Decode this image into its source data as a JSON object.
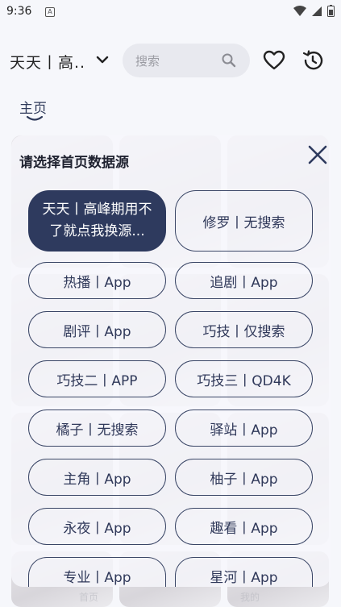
{
  "status_bar": {
    "time": "9:36",
    "notif_icon": "a-icon"
  },
  "header": {
    "source_label": "天天丨高..",
    "search_placeholder": "搜索"
  },
  "tabs": [
    {
      "label": "主页"
    }
  ],
  "background_nav": {
    "left_label": "首页",
    "right_label": "我的"
  },
  "dialog": {
    "title": "请选择首页数据源",
    "options": [
      {
        "label": "天天丨高峰期用不了就点我换源...",
        "selected": true
      },
      {
        "label": "修罗丨无搜索",
        "selected": false
      },
      {
        "label": "热播丨App",
        "selected": false
      },
      {
        "label": "追剧丨App",
        "selected": false
      },
      {
        "label": "剧评丨App",
        "selected": false
      },
      {
        "label": "巧技丨仅搜索",
        "selected": false
      },
      {
        "label": "巧技二丨APP",
        "selected": false
      },
      {
        "label": "巧技三丨QD4K",
        "selected": false
      },
      {
        "label": "橘子丨无搜索",
        "selected": false
      },
      {
        "label": "驿站丨App",
        "selected": false
      },
      {
        "label": "主角丨App",
        "selected": false
      },
      {
        "label": "柚子丨App",
        "selected": false
      },
      {
        "label": "永夜丨App",
        "selected": false
      },
      {
        "label": "趣看丨App",
        "selected": false
      },
      {
        "label": "专业丨App",
        "selected": false
      },
      {
        "label": "星河丨App",
        "selected": false
      }
    ]
  },
  "colors": {
    "accent": "#2e3a5e",
    "background": "#f6f7fb"
  }
}
